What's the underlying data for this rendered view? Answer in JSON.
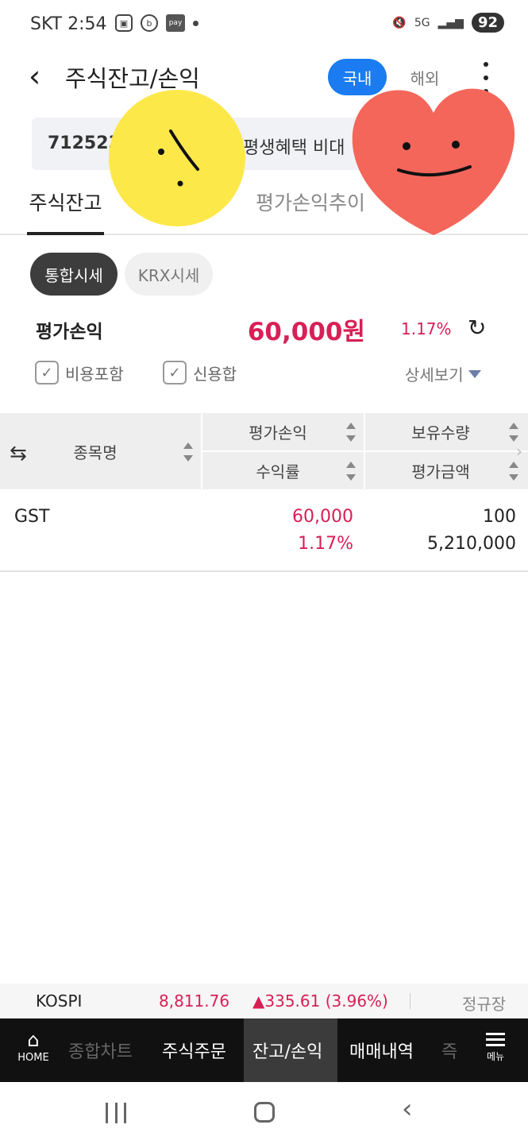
{
  "status_bar": {
    "carrier_time": "SKT 2:54",
    "pay_label": "pay",
    "network": "5G",
    "battery": "92"
  },
  "header": {
    "title": "주식잔고/손익",
    "domestic_button": "국내",
    "overseas_button": "해외"
  },
  "account": {
    "number": "712523",
    "name": "평생혜택 비대"
  },
  "tabs": [
    "주식잔고",
    "평가손익추이"
  ],
  "price_chips": [
    "통합시세",
    "KRX시세"
  ],
  "summary": {
    "label": "평가손익",
    "amount": "60,000원",
    "rate": "1.17%"
  },
  "options": {
    "include_fee": "비용포함",
    "credit_sum": "신용합",
    "detail_view": "상세보기"
  },
  "table": {
    "headers": {
      "name": "종목명",
      "profit_loss": "평가손익",
      "quantity": "보유수량",
      "return_rate": "수익률",
      "valuation": "평가금액"
    },
    "rows": [
      {
        "name": "GST",
        "profit_loss": "60,000",
        "return_rate": "1.17%",
        "quantity": "100",
        "valuation": "5,210,000"
      }
    ]
  },
  "ticker": {
    "name": "KOSPI",
    "value": "8,811.76",
    "change": "▲335.61 (3.96%)",
    "session": "정규장"
  },
  "bottom_nav": {
    "home": "HOME",
    "items": [
      "종합차트",
      "주식주문",
      "잔고/손익",
      "매매내역",
      "즉"
    ],
    "menu": "메뉴"
  },
  "colors": {
    "accent_blue": "#1a7cf0",
    "profit_red": "#d81f56",
    "sticker_yellow": "#fde84a",
    "sticker_heart": "#f4665a"
  }
}
